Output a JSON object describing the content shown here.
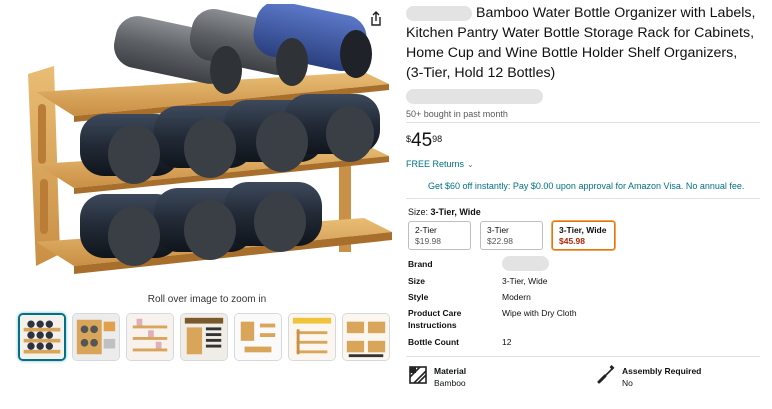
{
  "gallery": {
    "zoom_hint": "Roll over image to zoom in",
    "thumbnails": [
      {
        "icon": "thumb-rack-dark-bottles-icon"
      },
      {
        "icon": "thumb-rack-detail-icon"
      },
      {
        "icon": "thumb-rack-shelf-icon"
      },
      {
        "icon": "thumb-label-stickers-icon"
      },
      {
        "icon": "thumb-parts-icon"
      },
      {
        "icon": "thumb-easy-assembly-icon"
      },
      {
        "icon": "thumb-stacked-racks-icon"
      }
    ]
  },
  "product": {
    "title": "Bamboo Water Bottle Organizer with Labels, Kitchen Pantry Water Bottle Storage Rack for Cabinets, Home Cup and Wine Bottle Holder Shelf Organizers, (3-Tier, Hold 12 Bottles)",
    "bought_info": "50+ bought in past month",
    "price": {
      "symbol": "$",
      "whole": "45",
      "fraction": "98"
    },
    "returns": "FREE Returns",
    "promo": "Get $60 off instantly: Pay $0.00 upon approval for Amazon Visa. No annual fee.",
    "size_label": "Size:",
    "size_selected": "3-Tier, Wide",
    "sizes": [
      {
        "label": "2-Tier",
        "price": "$19.98"
      },
      {
        "label": "3-Tier",
        "price": "$22.98"
      },
      {
        "label": "3-Tier, Wide",
        "price": "$45.98"
      }
    ],
    "specs": [
      {
        "key": "Brand",
        "value": ""
      },
      {
        "key": "Size",
        "value": "3-Tier, Wide"
      },
      {
        "key": "Style",
        "value": "Modern"
      },
      {
        "key": "Product Care Instructions",
        "value": "Wipe with Dry Cloth"
      },
      {
        "key": "Bottle Count",
        "value": "12"
      }
    ],
    "features": [
      {
        "key": "Material",
        "value": "Bamboo",
        "icon": "material-icon"
      },
      {
        "key": "Assembly Required",
        "value": "No",
        "icon": "screwdriver-icon"
      }
    ]
  },
  "colors": {
    "link": "#007185",
    "deal_price": "#b12704",
    "selected_border": "#e77600",
    "bamboo": "#d9a55b"
  }
}
